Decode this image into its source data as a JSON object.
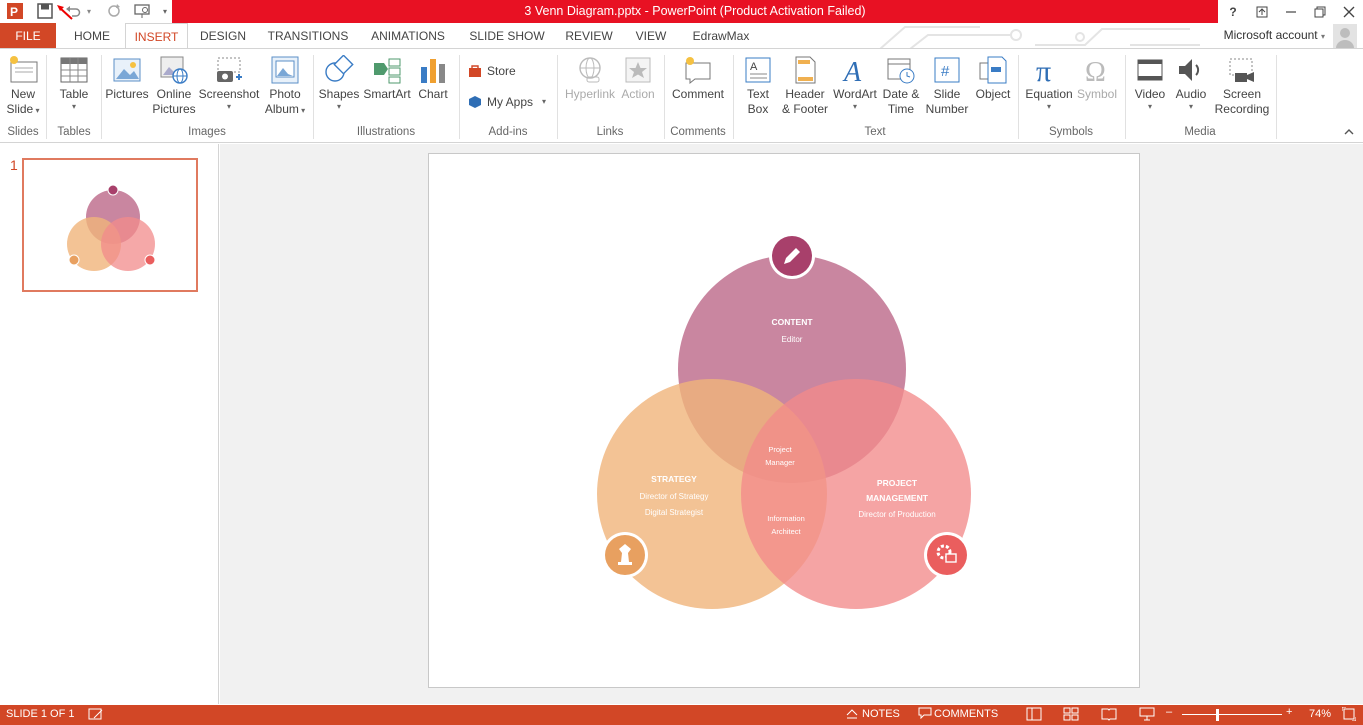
{
  "window": {
    "title": "3 Venn Diagram.pptx - PowerPoint (Product Activation Failed)",
    "help": "?",
    "controls": [
      "restore-ribbon",
      "minimize",
      "restore",
      "close"
    ]
  },
  "tabs": [
    "FILE",
    "HOME",
    "INSERT",
    "DESIGN",
    "TRANSITIONS",
    "ANIMATIONS",
    "SLIDE SHOW",
    "REVIEW",
    "VIEW",
    "EdrawMax"
  ],
  "active_tab": "INSERT",
  "account": "Microsoft account",
  "ribbon": {
    "slides": {
      "new_slide": [
        "New",
        "Slide"
      ],
      "group": "Slides"
    },
    "tables": {
      "table": "Table",
      "group": "Tables"
    },
    "images": {
      "pictures": "Pictures",
      "online_pictures": [
        "Online",
        "Pictures"
      ],
      "screenshot": "Screenshot",
      "photo_album": [
        "Photo",
        "Album"
      ],
      "group": "Images"
    },
    "illustrations": {
      "shapes": "Shapes",
      "smartart": "SmartArt",
      "chart": "Chart",
      "group": "Illustrations"
    },
    "addins": {
      "store": "Store",
      "my_apps": "My Apps",
      "group": "Add-ins"
    },
    "links": {
      "hyperlink": "Hyperlink",
      "action": "Action",
      "group": "Links"
    },
    "comments": {
      "comment": "Comment",
      "group": "Comments"
    },
    "text": {
      "text_box": [
        "Text",
        "Box"
      ],
      "header_footer": [
        "Header",
        "& Footer"
      ],
      "wordart": "WordArt",
      "date_time": [
        "Date &",
        "Time"
      ],
      "slide_number": [
        "Slide",
        "Number"
      ],
      "object": "Object",
      "group": "Text"
    },
    "symbols": {
      "equation": "Equation",
      "symbol": "Symbol",
      "group": "Symbols"
    },
    "media": {
      "video": "Video",
      "audio": "Audio",
      "screen_recording": [
        "Screen",
        "Recording"
      ],
      "group": "Media"
    }
  },
  "thumbnail": {
    "number": "1"
  },
  "slide": {
    "content": {
      "title": "CONTENT",
      "sub": "Editor",
      "color": "#c0718f"
    },
    "strategy": {
      "title": "STRATEGY",
      "sub1": "Director of Strategy",
      "sub2": "Digital Strategist",
      "color": "#f0b47a"
    },
    "project": {
      "title1": "PROJECT",
      "title2": "MANAGEMENT",
      "sub": "Director of Production",
      "color": "#f28b8b"
    },
    "overlap_top": [
      "Project",
      "Manager"
    ],
    "overlap_bottom": [
      "Information",
      "Architect"
    ]
  },
  "status": {
    "slide_info": "SLIDE 1 OF 1",
    "notes": "NOTES",
    "comments": "COMMENTS",
    "zoom": "74%"
  },
  "colors": {
    "accent": "#d24726",
    "title_red": "#e81123"
  }
}
